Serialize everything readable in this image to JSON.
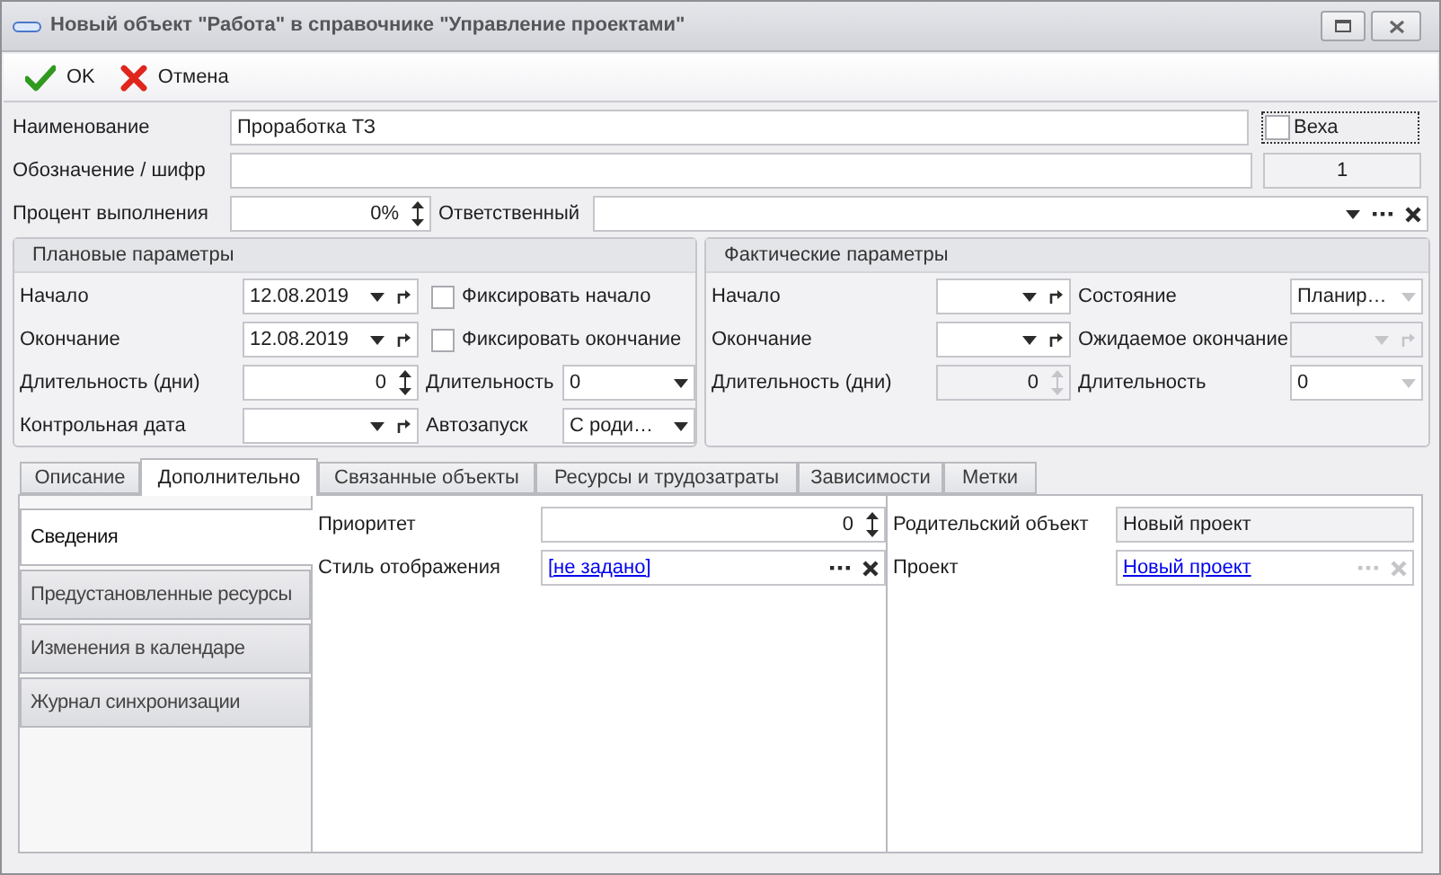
{
  "window": {
    "title": "Новый объект \"Работа\" в справочнике \"Управление проектами\""
  },
  "toolbar": [
    {
      "kind": "ok",
      "label": "OK"
    },
    {
      "kind": "cancel",
      "label": "Отмена"
    }
  ],
  "name_field": {
    "label": "Наименование",
    "value": "Проработка ТЗ"
  },
  "milestone": {
    "label": "Веха",
    "checked": false
  },
  "code_field": {
    "label": "Обозначение / шифр"
  },
  "number": "1",
  "percent_field": {
    "label": "Процент выполнения",
    "value": "0%"
  },
  "responsible_field": {
    "label": "Ответственный"
  },
  "groups": [
    {
      "title": "Плановые параметры",
      "rows": [
        [
          {
            "kind": "date",
            "label": "Начало",
            "value": "12.08.2019",
            "disabled": false
          },
          {
            "kind": "checkbox",
            "label": "Фиксировать начало",
            "checked": false
          }
        ],
        [
          {
            "kind": "date",
            "label": "Окончание",
            "value": "12.08.2019",
            "disabled": false
          },
          {
            "kind": "checkbox",
            "label": "Фиксировать окончание",
            "checked": false
          }
        ],
        [
          {
            "kind": "spin",
            "label": "Длительность (дни)",
            "value": "0",
            "disabled": false
          },
          {
            "kind": "combo",
            "label": "Длительность",
            "value": "0",
            "disabled": false
          }
        ],
        [
          {
            "kind": "date",
            "label": "Контрольная дата",
            "disabled": false
          },
          {
            "kind": "combo",
            "label": "Автозапуск",
            "value": "С роди…",
            "disabled": false
          }
        ]
      ]
    },
    {
      "title": "Фактические параметры",
      "rows": [
        [
          {
            "kind": "date",
            "label": "Начало",
            "disabled": false
          },
          {
            "kind": "combo",
            "label": "Состояние",
            "value": "Планир…",
            "disabled": true
          }
        ],
        [
          {
            "kind": "date",
            "label": "Окончание",
            "disabled": false
          },
          {
            "kind": "date",
            "label": "Ожидаемое окончание",
            "disabled": true
          }
        ],
        [
          {
            "kind": "spin",
            "label": "Длительность (дни)",
            "value": "0",
            "disabled": true
          },
          {
            "kind": "combo",
            "label": "Длительность",
            "value": "0",
            "disabled": true
          }
        ]
      ]
    }
  ],
  "tabs": [
    {
      "label": "Описание",
      "selected": false
    },
    {
      "label": "Дополнительно",
      "selected": true
    },
    {
      "label": "Связанные объекты",
      "selected": false
    },
    {
      "label": "Ресурсы и трудозатраты",
      "selected": false
    },
    {
      "label": "Зависимости",
      "selected": false
    },
    {
      "label": "Метки",
      "selected": false
    }
  ],
  "side_tabs": [
    {
      "label": "Сведения",
      "selected": true
    },
    {
      "label": "Предустановленные ресурсы",
      "selected": false
    },
    {
      "label": "Изменения в календаре",
      "selected": false
    },
    {
      "label": "Журнал синхронизации",
      "selected": false
    }
  ],
  "details": {
    "left": [
      {
        "kind": "spin",
        "label": "Приоритет",
        "value": "0",
        "disabled": false
      },
      {
        "kind": "link",
        "label": "Стиль отображения",
        "value": "[не задано]",
        "disabled": false
      }
    ],
    "right": [
      {
        "kind": "readonly",
        "label": "Родительский объект",
        "value": "Новый проект"
      },
      {
        "kind": "link",
        "label": "Проект",
        "value": "Новый проект",
        "disabled": true
      }
    ]
  }
}
